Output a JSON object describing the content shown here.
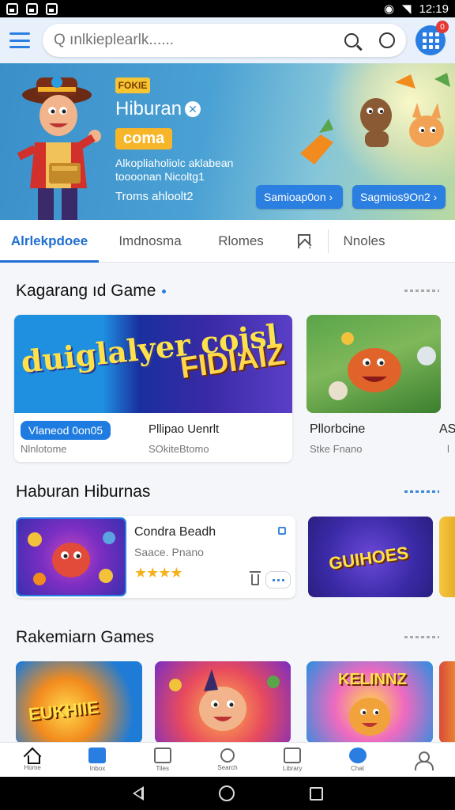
{
  "status_bar": {
    "time": "12:19"
  },
  "search": {
    "placeholder": "Q ınlkieplearlk......",
    "value": "",
    "notification_count": "0"
  },
  "banner": {
    "small_logo": "FOKIE",
    "title": "Hiburan",
    "tag": "coma",
    "description": "Alkopliaholiolc aklabean toooonan Nicoltg1",
    "footer_text": "Troms ahloolt2",
    "button1_label": "Samioap0on ›",
    "button2_label": "Sagmios9On2 ›"
  },
  "tabs": [
    {
      "label": "Alrlekpdoee",
      "active": true
    },
    {
      "label": "Imdnosma",
      "active": false
    },
    {
      "label": "Rlomes",
      "active": false
    },
    {
      "label": "",
      "icon": "bookmark-icon",
      "active": false
    },
    {
      "label": "Nnoles",
      "active": false
    }
  ],
  "section1": {
    "title": "Kagarang ıd Game",
    "featured": {
      "art_text1": "duiglalyer cojsl",
      "art_text2": "FIDIAIZ",
      "pill": "Vlaneod 0on05",
      "sub": "Nlnlotome",
      "name2": "Pllipao Uenrlt",
      "sub2": "SOkiteBtomo"
    },
    "card2": {
      "name": "Pllorbcine",
      "sub": "Stke Fnano"
    },
    "card3": {
      "name": "AS",
      "sub": "l"
    }
  },
  "section2": {
    "title": "Haburan Hiburnas",
    "list_card": {
      "name": "Condra Beadh",
      "sub": "Saace. Pnano",
      "stars": "★★★★"
    },
    "tile_text": "GUIHOES"
  },
  "section3": {
    "title": "Rakemiarn Games",
    "tiles": [
      {
        "text": "EUKHIIE"
      },
      {
        "text": ""
      },
      {
        "text": "KELINNZ"
      }
    ]
  },
  "bottom_nav": [
    {
      "label": "Home",
      "icon": "home-icon"
    },
    {
      "label": "Inbox",
      "icon": "games-icon"
    },
    {
      "label": "Tiles",
      "icon": "tiles-icon"
    },
    {
      "label": "Search",
      "icon": "search-icon"
    },
    {
      "label": "Library",
      "icon": "library-icon"
    },
    {
      "label": "Chat",
      "icon": "chat-icon"
    },
    {
      "label": "",
      "icon": "user-icon"
    }
  ],
  "colors": {
    "accent": "#2a7de1",
    "star": "#f6b21a",
    "banner_blue": "#3a8fc9"
  }
}
